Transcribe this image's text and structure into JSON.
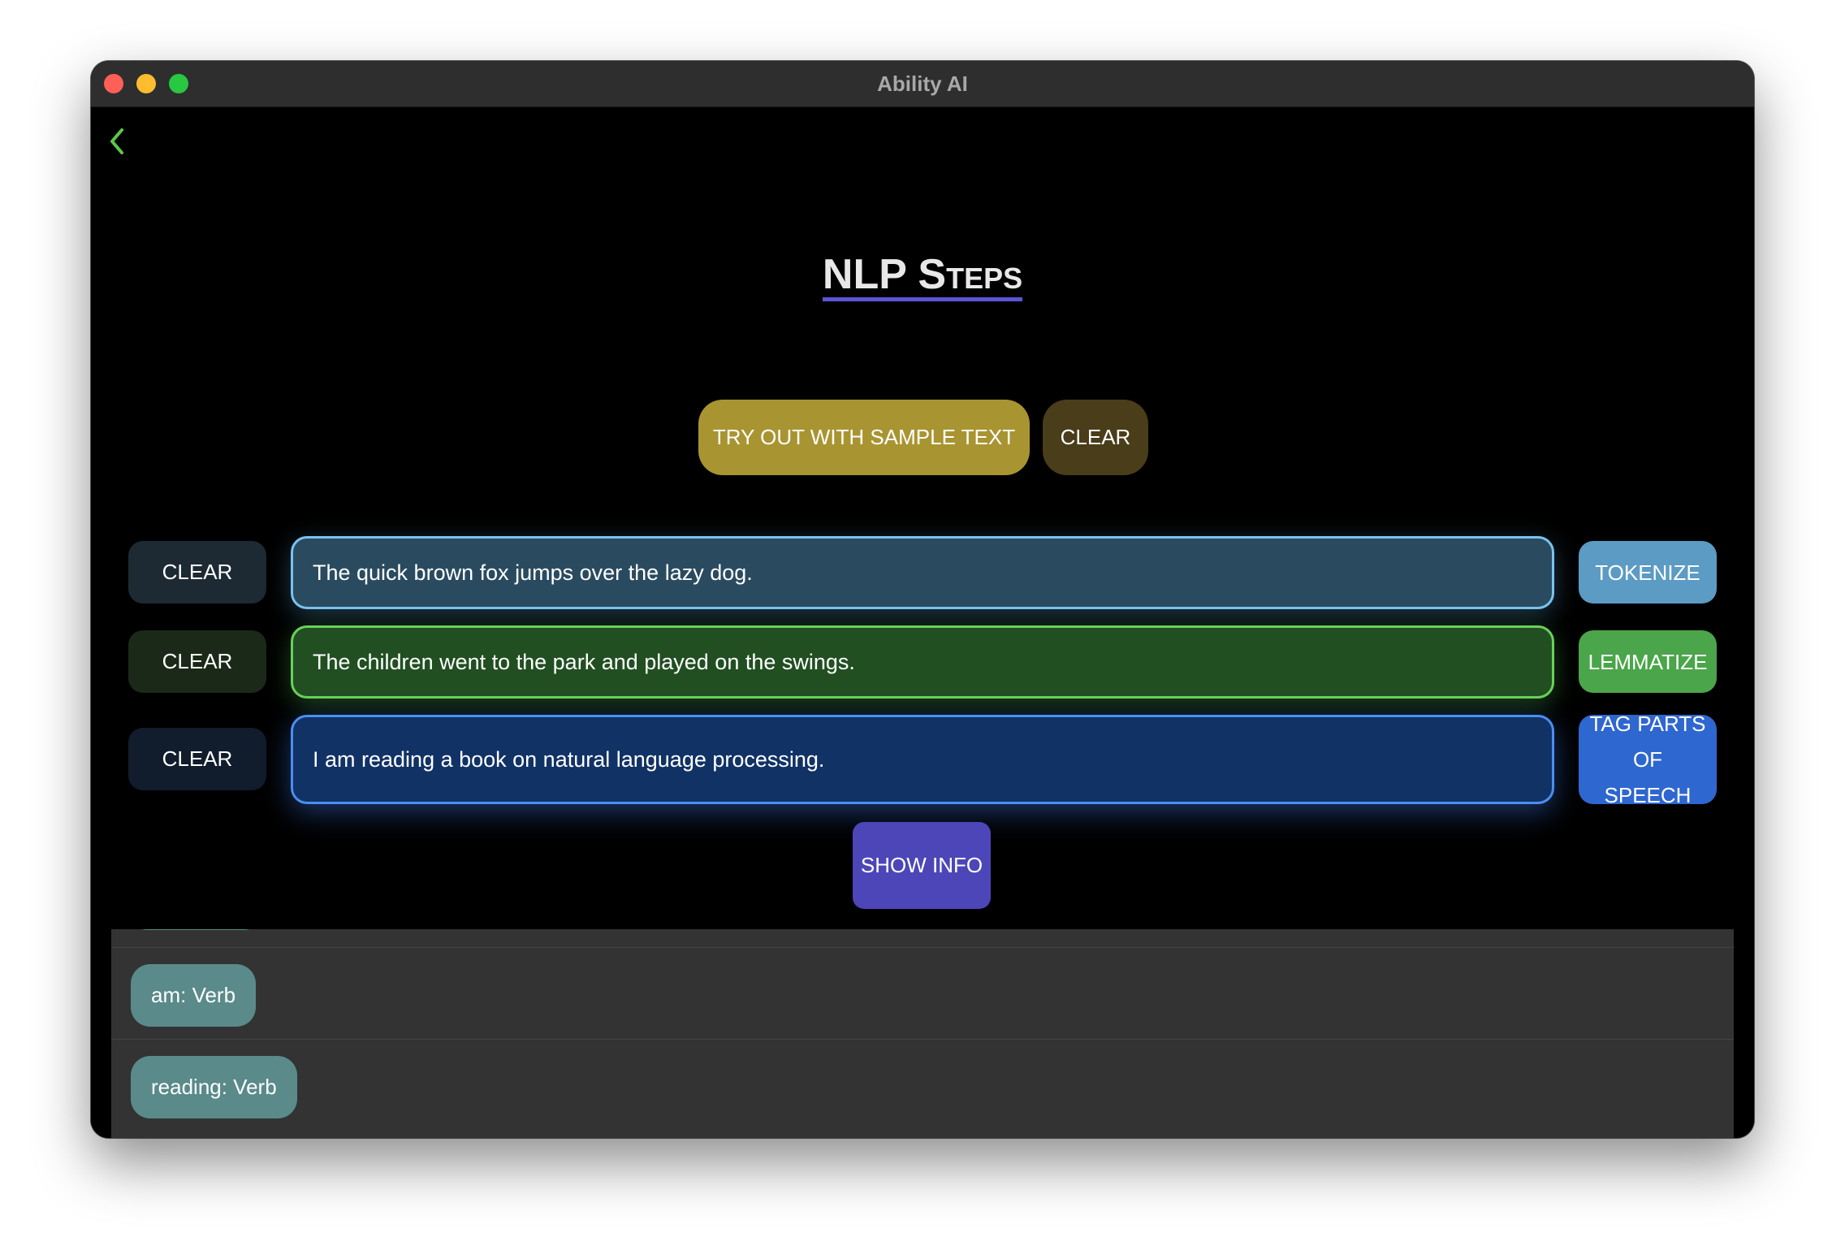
{
  "window": {
    "title": "Ability AI"
  },
  "header": {
    "back_icon": "chevron-left-icon",
    "page_title": "NLP Steps"
  },
  "top_actions": {
    "sample_label": "TRY OUT WITH SAMPLE TEXT",
    "clear_label": "CLEAR"
  },
  "rows": [
    {
      "clear_label": "CLEAR",
      "text": "The quick brown fox jumps over the lazy dog.",
      "action_label": "TOKENIZE"
    },
    {
      "clear_label": "CLEAR",
      "text": "The children went to the park and played on the swings.",
      "action_label": "LEMMATIZE"
    },
    {
      "clear_label": "CLEAR",
      "text": "I am reading a book on natural language processing.",
      "action_label": "TAG PARTS OF SPEECH"
    }
  ],
  "show_info_label": "SHOW INFO",
  "results": [
    {
      "label": "am: Verb"
    },
    {
      "label": "reading: Verb"
    }
  ],
  "colors": {
    "accent_underline": "#5b54d6",
    "sample_button": "#a99432",
    "tokenize": "#5b9bc4",
    "lemmatize": "#4ba54a",
    "tag_pos": "#2f67d0",
    "show_info": "#4c46b8",
    "chip": "#5a8a8a",
    "back_arrow": "#5cc94a"
  }
}
